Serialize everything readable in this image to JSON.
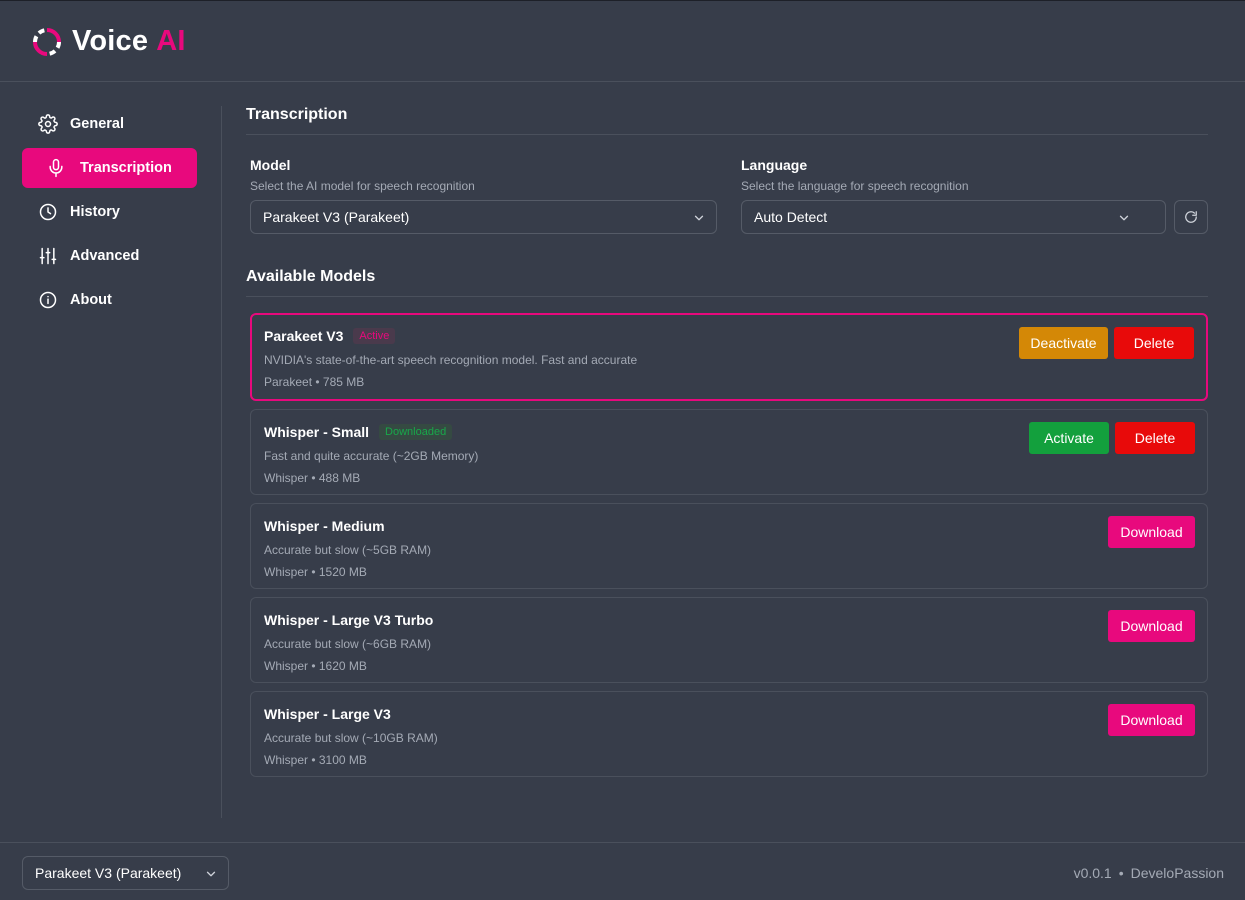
{
  "app": {
    "logo_word1": "Voice",
    "logo_word2": "AI",
    "accent_color": "#e8097d"
  },
  "sidebar": {
    "items": [
      {
        "label": "General",
        "icon": "gear-icon"
      },
      {
        "label": "Transcription",
        "icon": "microphone-icon",
        "active": true
      },
      {
        "label": "History",
        "icon": "clock-icon"
      },
      {
        "label": "Advanced",
        "icon": "sliders-icon"
      },
      {
        "label": "About",
        "icon": "info-icon"
      }
    ]
  },
  "main": {
    "section_title": "Transcription",
    "model": {
      "label": "Model",
      "description": "Select the AI model for speech recognition",
      "value": "Parakeet V3 (Parakeet)"
    },
    "language": {
      "label": "Language",
      "description": "Select the language for speech recognition",
      "value": "Auto Detect"
    },
    "available_models_title": "Available Models",
    "models": [
      {
        "name": "Parakeet V3",
        "badge": "Active",
        "description": "NVIDIA's state-of-the-art speech recognition model. Fast and accurate",
        "meta": "Parakeet • 785 MB",
        "actions": [
          "Deactivate",
          "Delete"
        ]
      },
      {
        "name": "Whisper - Small",
        "badge": "Downloaded",
        "description": "Fast and quite accurate (~2GB Memory)",
        "meta": "Whisper • 488 MB",
        "actions": [
          "Activate",
          "Delete"
        ]
      },
      {
        "name": "Whisper - Medium",
        "description": "Accurate but slow (~5GB RAM)",
        "meta": "Whisper • 1520 MB",
        "actions": [
          "Download"
        ]
      },
      {
        "name": "Whisper - Large V3 Turbo",
        "description": "Accurate but slow (~6GB RAM)",
        "meta": "Whisper • 1620 MB",
        "actions": [
          "Download"
        ]
      },
      {
        "name": "Whisper - Large V3",
        "description": "Accurate but slow (~10GB RAM)",
        "meta": "Whisper • 3100 MB",
        "actions": [
          "Download"
        ]
      }
    ]
  },
  "footer": {
    "model_select_value": "Parakeet V3 (Parakeet)",
    "version": "v0.0.1",
    "separator": "•",
    "author": "DeveloPassion"
  }
}
